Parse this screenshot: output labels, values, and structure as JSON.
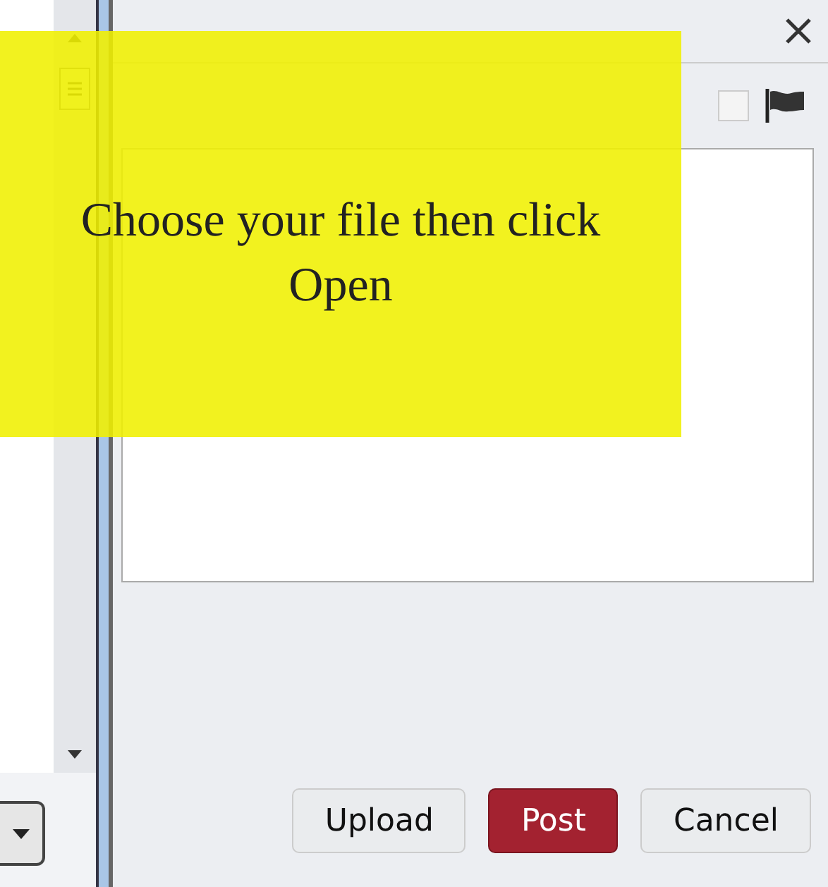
{
  "callout": {
    "text": "Choose your file then click Open"
  },
  "toolbar": {
    "checkbox": {
      "checked": false
    }
  },
  "buttons": [
    {
      "label": "Upload",
      "kind": "normal"
    },
    {
      "label": "Post",
      "kind": "primary"
    },
    {
      "label": "Cancel",
      "kind": "normal"
    }
  ]
}
